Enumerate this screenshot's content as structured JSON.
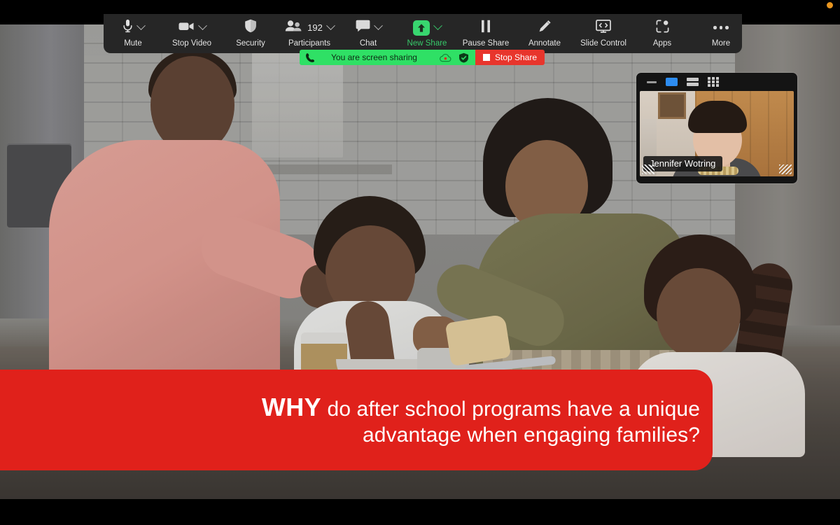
{
  "window": {
    "recording_indicator": "recording-dot",
    "recording_color": "#e8951f"
  },
  "toolbar": {
    "items": [
      {
        "name": "mute",
        "label": "Mute",
        "icon": "microphone-icon",
        "has_chevron": true,
        "badge": ""
      },
      {
        "name": "stop-video",
        "label": "Stop Video",
        "icon": "video-camera-icon",
        "has_chevron": true,
        "badge": ""
      },
      {
        "name": "security",
        "label": "Security",
        "icon": "shield-icon",
        "has_chevron": false,
        "badge": ""
      },
      {
        "name": "participants",
        "label": "Participants",
        "icon": "people-icon",
        "has_chevron": true,
        "badge": "192"
      },
      {
        "name": "chat",
        "label": "Chat",
        "icon": "chat-bubble-icon",
        "has_chevron": true,
        "badge": ""
      },
      {
        "name": "new-share",
        "label": "New Share",
        "icon": "up-arrow-icon",
        "has_chevron": true,
        "badge": ""
      },
      {
        "name": "pause-share",
        "label": "Pause Share",
        "icon": "pause-icon",
        "has_chevron": false,
        "badge": ""
      },
      {
        "name": "annotate",
        "label": "Annotate",
        "icon": "pencil-icon",
        "has_chevron": false,
        "badge": ""
      },
      {
        "name": "slide-control",
        "label": "Slide Control",
        "icon": "slide-control-icon",
        "has_chevron": false,
        "badge": ""
      },
      {
        "name": "apps",
        "label": "Apps",
        "icon": "apps-icon",
        "has_chevron": false,
        "badge": ""
      },
      {
        "name": "more",
        "label": "More",
        "icon": "ellipsis-icon",
        "has_chevron": false,
        "badge": ""
      }
    ],
    "participant_count": "192",
    "new_share_accent": "#37c96a",
    "background": "#262626"
  },
  "share_bar": {
    "status_text": "You are screen sharing",
    "stop_label": "Stop Share",
    "green": "#2fe065",
    "red": "#e8352c",
    "icons": [
      "phone-icon",
      "cloud-record-icon",
      "shield-check-icon",
      "stop-square-icon"
    ]
  },
  "video_thumbnail": {
    "participant_name": "Jennifer Wotring",
    "view_buttons": [
      "minimize-icon",
      "active-speaker-view-icon",
      "gallery-view-icon",
      "grid-view-icon"
    ],
    "active_view": "active-speaker-view-icon",
    "active_color": "#2d8cf0"
  },
  "slide": {
    "banner_color": "#e0211b",
    "heading_emphasis": "WHY",
    "heading_rest": " do after school programs have a unique advantage when engaging families?",
    "photo_alt": "family-cooking-in-kitchen-photo"
  }
}
